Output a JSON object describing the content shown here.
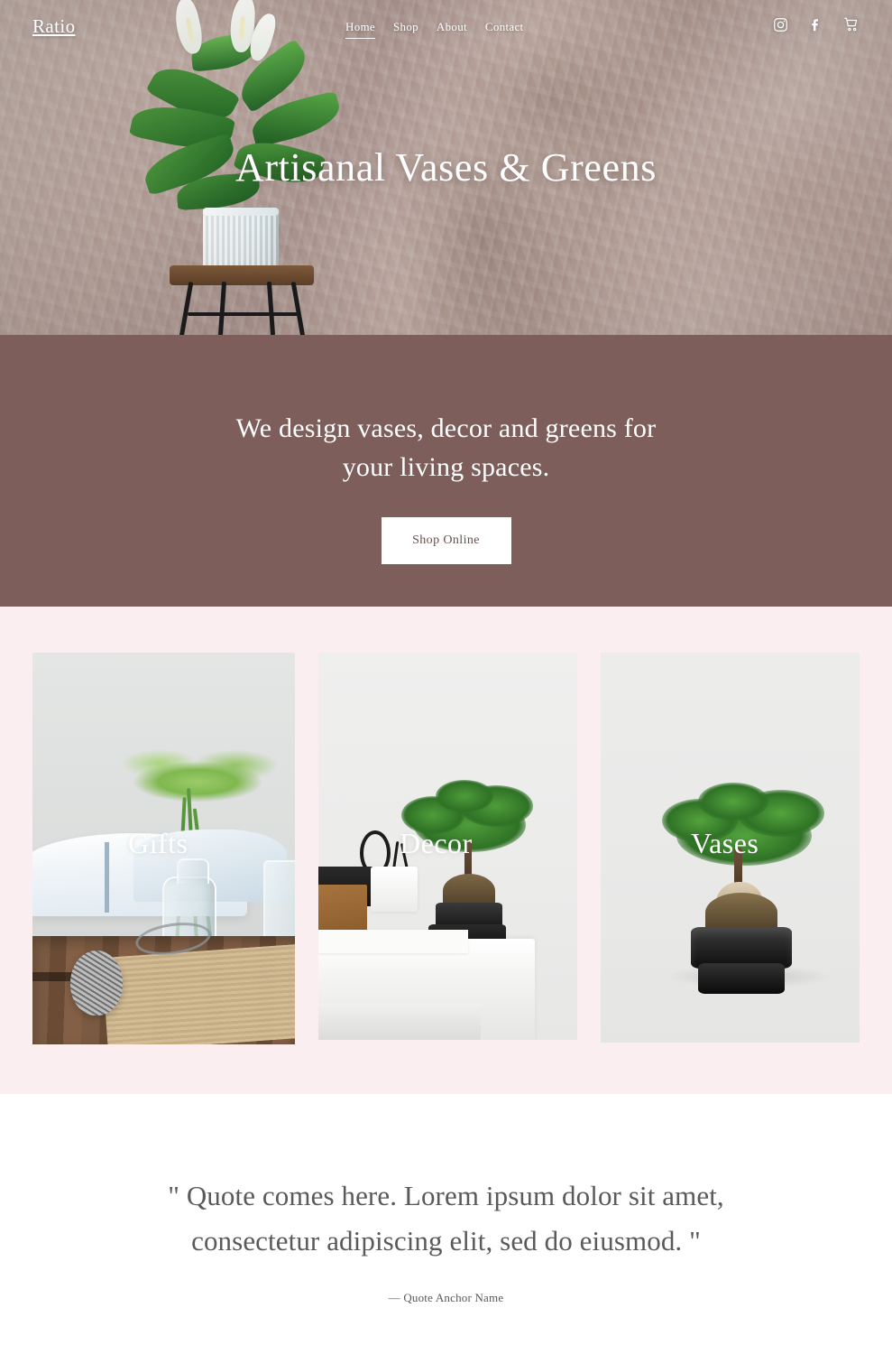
{
  "header": {
    "logo": "Ratio",
    "nav": [
      {
        "label": "Home",
        "active": true
      },
      {
        "label": "Shop",
        "active": false
      },
      {
        "label": "About",
        "active": false
      },
      {
        "label": "Contact",
        "active": false
      }
    ],
    "social": [
      {
        "name": "instagram-icon"
      },
      {
        "name": "facebook-icon"
      },
      {
        "name": "cart-icon"
      }
    ]
  },
  "hero": {
    "title": "Artisanal Vases & Greens",
    "background_description": "textured plaster wall with peace lily plant on wooden stool"
  },
  "band": {
    "tagline_line1": "We design vases, decor and greens for",
    "tagline_line2": "your living spaces.",
    "button_label": "Shop Online",
    "background_color": "#7d5e5b",
    "button_text_color": "#6b4f4c"
  },
  "cards_section": {
    "background_color": "#fbeef0",
    "cards": [
      {
        "label": "Gifts",
        "image_description": "glass vase with greens on burlap beside open book and twine ball"
      },
      {
        "label": "Decor",
        "image_description": "bonsai in black pot on white desk with stationery"
      },
      {
        "label": "Vases",
        "image_description": "bonsai ficus in glossy black pot on white background"
      }
    ]
  },
  "quote": {
    "line1": "\" Quote comes here. Lorem ipsum dolor sit amet,",
    "line2": "consectetur adipiscing elit, sed do eiusmod. \"",
    "anchor": "— Quote Anchor Name",
    "text_color": "#5a5a5a"
  }
}
